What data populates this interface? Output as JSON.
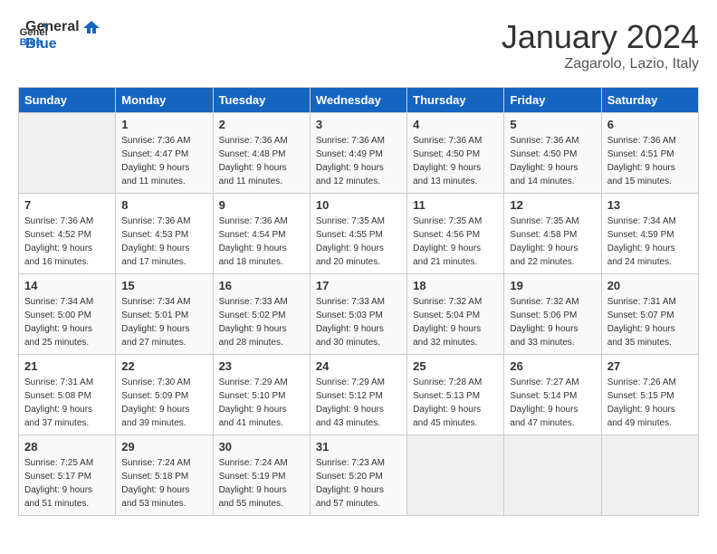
{
  "header": {
    "logo_general": "General",
    "logo_blue": "Blue",
    "month_title": "January 2024",
    "subtitle": "Zagarolo, Lazio, Italy"
  },
  "weekdays": [
    "Sunday",
    "Monday",
    "Tuesday",
    "Wednesday",
    "Thursday",
    "Friday",
    "Saturday"
  ],
  "weeks": [
    [
      {
        "day": "",
        "sunrise": "",
        "sunset": "",
        "daylight": ""
      },
      {
        "day": "1",
        "sunrise": "7:36 AM",
        "sunset": "4:47 PM",
        "daylight": "9 hours and 11 minutes."
      },
      {
        "day": "2",
        "sunrise": "7:36 AM",
        "sunset": "4:48 PM",
        "daylight": "9 hours and 11 minutes."
      },
      {
        "day": "3",
        "sunrise": "7:36 AM",
        "sunset": "4:49 PM",
        "daylight": "9 hours and 12 minutes."
      },
      {
        "day": "4",
        "sunrise": "7:36 AM",
        "sunset": "4:50 PM",
        "daylight": "9 hours and 13 minutes."
      },
      {
        "day": "5",
        "sunrise": "7:36 AM",
        "sunset": "4:50 PM",
        "daylight": "9 hours and 14 minutes."
      },
      {
        "day": "6",
        "sunrise": "7:36 AM",
        "sunset": "4:51 PM",
        "daylight": "9 hours and 15 minutes."
      }
    ],
    [
      {
        "day": "7",
        "sunrise": "7:36 AM",
        "sunset": "4:52 PM",
        "daylight": "9 hours and 16 minutes."
      },
      {
        "day": "8",
        "sunrise": "7:36 AM",
        "sunset": "4:53 PM",
        "daylight": "9 hours and 17 minutes."
      },
      {
        "day": "9",
        "sunrise": "7:36 AM",
        "sunset": "4:54 PM",
        "daylight": "9 hours and 18 minutes."
      },
      {
        "day": "10",
        "sunrise": "7:35 AM",
        "sunset": "4:55 PM",
        "daylight": "9 hours and 20 minutes."
      },
      {
        "day": "11",
        "sunrise": "7:35 AM",
        "sunset": "4:56 PM",
        "daylight": "9 hours and 21 minutes."
      },
      {
        "day": "12",
        "sunrise": "7:35 AM",
        "sunset": "4:58 PM",
        "daylight": "9 hours and 22 minutes."
      },
      {
        "day": "13",
        "sunrise": "7:34 AM",
        "sunset": "4:59 PM",
        "daylight": "9 hours and 24 minutes."
      }
    ],
    [
      {
        "day": "14",
        "sunrise": "7:34 AM",
        "sunset": "5:00 PM",
        "daylight": "9 hours and 25 minutes."
      },
      {
        "day": "15",
        "sunrise": "7:34 AM",
        "sunset": "5:01 PM",
        "daylight": "9 hours and 27 minutes."
      },
      {
        "day": "16",
        "sunrise": "7:33 AM",
        "sunset": "5:02 PM",
        "daylight": "9 hours and 28 minutes."
      },
      {
        "day": "17",
        "sunrise": "7:33 AM",
        "sunset": "5:03 PM",
        "daylight": "9 hours and 30 minutes."
      },
      {
        "day": "18",
        "sunrise": "7:32 AM",
        "sunset": "5:04 PM",
        "daylight": "9 hours and 32 minutes."
      },
      {
        "day": "19",
        "sunrise": "7:32 AM",
        "sunset": "5:06 PM",
        "daylight": "9 hours and 33 minutes."
      },
      {
        "day": "20",
        "sunrise": "7:31 AM",
        "sunset": "5:07 PM",
        "daylight": "9 hours and 35 minutes."
      }
    ],
    [
      {
        "day": "21",
        "sunrise": "7:31 AM",
        "sunset": "5:08 PM",
        "daylight": "9 hours and 37 minutes."
      },
      {
        "day": "22",
        "sunrise": "7:30 AM",
        "sunset": "5:09 PM",
        "daylight": "9 hours and 39 minutes."
      },
      {
        "day": "23",
        "sunrise": "7:29 AM",
        "sunset": "5:10 PM",
        "daylight": "9 hours and 41 minutes."
      },
      {
        "day": "24",
        "sunrise": "7:29 AM",
        "sunset": "5:12 PM",
        "daylight": "9 hours and 43 minutes."
      },
      {
        "day": "25",
        "sunrise": "7:28 AM",
        "sunset": "5:13 PM",
        "daylight": "9 hours and 45 minutes."
      },
      {
        "day": "26",
        "sunrise": "7:27 AM",
        "sunset": "5:14 PM",
        "daylight": "9 hours and 47 minutes."
      },
      {
        "day": "27",
        "sunrise": "7:26 AM",
        "sunset": "5:15 PM",
        "daylight": "9 hours and 49 minutes."
      }
    ],
    [
      {
        "day": "28",
        "sunrise": "7:25 AM",
        "sunset": "5:17 PM",
        "daylight": "9 hours and 51 minutes."
      },
      {
        "day": "29",
        "sunrise": "7:24 AM",
        "sunset": "5:18 PM",
        "daylight": "9 hours and 53 minutes."
      },
      {
        "day": "30",
        "sunrise": "7:24 AM",
        "sunset": "5:19 PM",
        "daylight": "9 hours and 55 minutes."
      },
      {
        "day": "31",
        "sunrise": "7:23 AM",
        "sunset": "5:20 PM",
        "daylight": "9 hours and 57 minutes."
      },
      {
        "day": "",
        "sunrise": "",
        "sunset": "",
        "daylight": ""
      },
      {
        "day": "",
        "sunrise": "",
        "sunset": "",
        "daylight": ""
      },
      {
        "day": "",
        "sunrise": "",
        "sunset": "",
        "daylight": ""
      }
    ]
  ]
}
